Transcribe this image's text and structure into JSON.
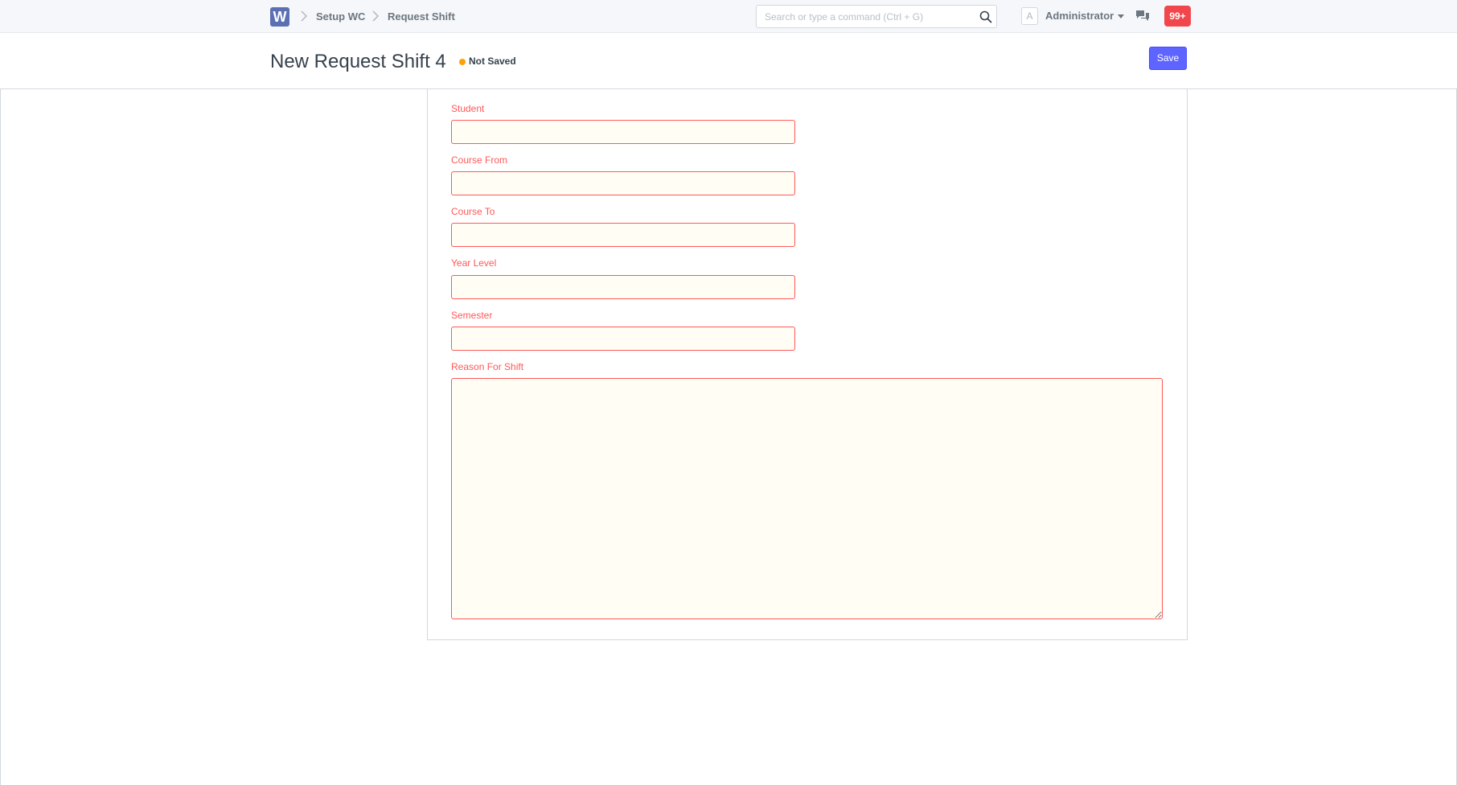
{
  "navbar": {
    "logo_letter": "W",
    "breadcrumbs": [
      "Setup WC",
      "Request Shift"
    ],
    "search": {
      "placeholder": "Search or type a command (Ctrl + G)",
      "value": ""
    },
    "user": {
      "avatar_initial": "A",
      "name": "Administrator"
    },
    "notifications_count": "99+",
    "icons": [
      "search-icon",
      "chevron-right-icon",
      "caret-down-icon",
      "chat-icon"
    ]
  },
  "page": {
    "title": "New Request Shift 4",
    "status": "Not Saved",
    "save_label": "Save"
  },
  "form": {
    "fields": [
      {
        "label": "Student",
        "value": ""
      },
      {
        "label": "Course From",
        "value": ""
      },
      {
        "label": "Course To",
        "value": ""
      },
      {
        "label": "Year Level",
        "value": ""
      },
      {
        "label": "Semester",
        "value": ""
      },
      {
        "label": "Reason For Shift",
        "value": ""
      }
    ]
  },
  "colors": {
    "accent": "#5e64ff",
    "required_border": "#ff5858",
    "required_bg": "#fffdf4",
    "status_dot": "#ffa00a",
    "badge": "#f1474c",
    "logo": "#5b6fb3"
  }
}
